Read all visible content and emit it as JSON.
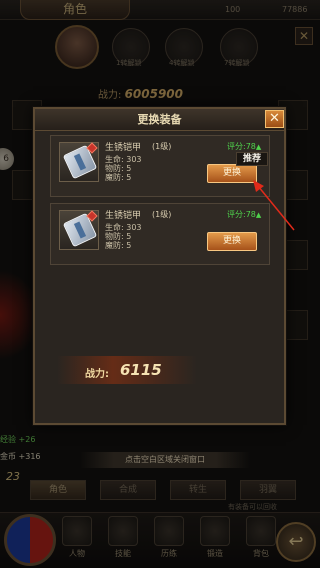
{
  "background": {
    "title": "角色",
    "resources": [
      "",
      "100",
      "77886"
    ],
    "locks": [
      "1转解锁",
      "4转解锁",
      "7转解锁"
    ],
    "power_label": "战力:",
    "power_value": "6005900",
    "exp_label": "经验",
    "exp_value": "+26",
    "gold_label": "金币",
    "gold_value": "+316",
    "level": "23",
    "hint": "点击空白区域关闭窗口",
    "tabs": [
      "角色",
      "合成",
      "转生",
      "羽翼"
    ],
    "note": "有装备可以回收",
    "menu": [
      "人物",
      "技能",
      "历练",
      "锻造",
      "背包"
    ]
  },
  "dialog": {
    "title": "更换装备",
    "close_label": "✕",
    "recommend_label": "推荐",
    "items": [
      {
        "name": "生锈铠甲",
        "level": "(1级)",
        "hp": "生命: 303",
        "pdef": "物防: 5",
        "mdef": "魔防: 5",
        "score": "评分:78",
        "button": "更换"
      },
      {
        "name": "生锈铠甲",
        "level": "(1级)",
        "hp": "生命: 303",
        "pdef": "物防: 5",
        "mdef": "魔防: 5",
        "score": "评分:78",
        "button": "更换"
      }
    ],
    "power_label": "战力:",
    "power_value": "6115"
  },
  "colors": {
    "panel": "#2a2520",
    "border": "#5c4a33",
    "button": "#d07a32",
    "score_green": "#4fd14c",
    "pointer_red": "#e02a1a"
  }
}
